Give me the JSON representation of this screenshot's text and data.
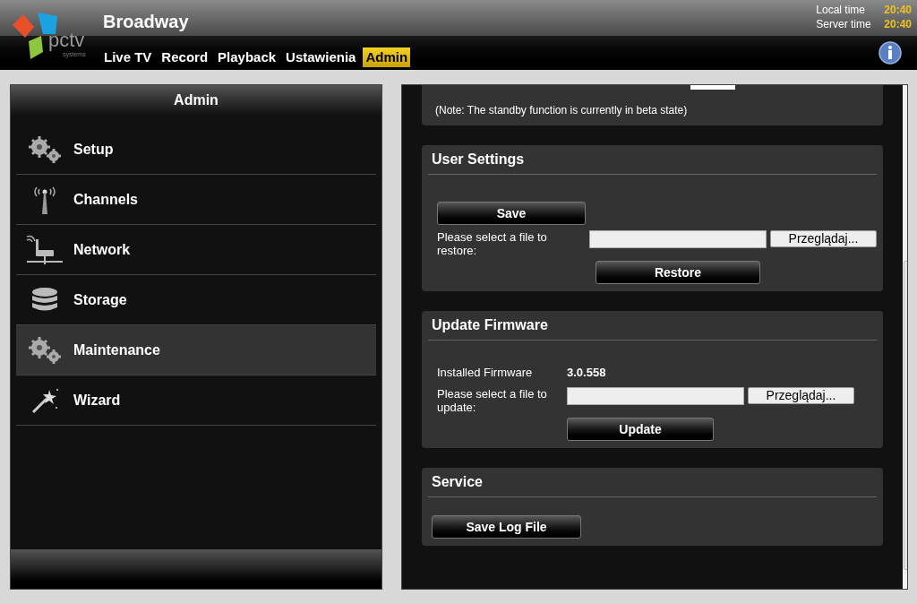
{
  "header": {
    "title": "Broadway",
    "logo_text": "pctv",
    "logo_subtext": "systems",
    "times": [
      {
        "label": "Local time",
        "value": "20:40"
      },
      {
        "label": "Server time",
        "value": "20:40"
      }
    ]
  },
  "nav": [
    {
      "label": "Live TV",
      "selected": false
    },
    {
      "label": "Record",
      "selected": false
    },
    {
      "label": "Playback",
      "selected": false
    },
    {
      "label": "Ustawienia",
      "selected": false
    },
    {
      "label": "Admin",
      "selected": true
    }
  ],
  "sidebar": {
    "title": "Admin",
    "items": [
      {
        "label": "Setup",
        "kind": "gears",
        "selected": false
      },
      {
        "label": "Channels",
        "kind": "antenna",
        "selected": false
      },
      {
        "label": "Network",
        "kind": "router",
        "selected": false
      },
      {
        "label": "Storage",
        "kind": "database",
        "selected": false
      },
      {
        "label": "Maintenance",
        "kind": "gears",
        "selected": true
      },
      {
        "label": "Wizard",
        "kind": "wand",
        "selected": false
      }
    ]
  },
  "note": "(Note: The standby function is currently in beta state)",
  "user_settings": {
    "title": "User Settings",
    "save_button": "Save",
    "restore_label": "Please select a file to restore:",
    "browse_button": "Przeglądaj...",
    "restore_button": "Restore"
  },
  "update_firmware": {
    "title": "Update Firmware",
    "installed_label": "Installed Firmware",
    "installed_value": "3.0.558",
    "file_label": "Please select a file to update:",
    "browse_button": "Przeglądaj...",
    "update_button": "Update"
  },
  "service": {
    "title": "Service",
    "save_log_button": "Save Log File"
  }
}
